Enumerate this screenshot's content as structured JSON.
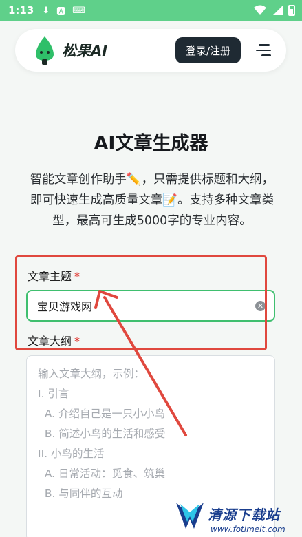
{
  "status_bar": {
    "time": "1:13",
    "icons": [
      "download-icon",
      "a-badge-icon",
      "keyboard-icon",
      "wifi-icon",
      "signal-icon",
      "battery-icon"
    ]
  },
  "header": {
    "brand": "松果AI",
    "login_label": "登录/注册",
    "brand_color": "#2fbf69"
  },
  "main": {
    "title": "AI文章生成器",
    "intro": "智能文章创作助手✏️，只需提供标题和大纲，即可快速生成高质量文章📝。支持多种文章类型，最高可生成5000字的专业内容。"
  },
  "form": {
    "topic_label": "文章主题",
    "topic_value": "宝贝游戏网",
    "outline_label": "文章大纲",
    "required_mark": "*",
    "outline_placeholder_lines": [
      "输入文章大纲，示例：",
      "I. 引言",
      "  A. 介绍自己是一只小小鸟",
      "  B. 简述小鸟的生活和感受",
      "",
      "II. 小鸟的生活",
      "  A. 日常活动：觅食、筑巢",
      "  B. 与同伴的互动"
    ]
  },
  "watermark": {
    "title": "清源下载站",
    "url": "www.fotimeit.com"
  },
  "colors": {
    "accent": "#3fbf6f",
    "annotation": "#e0483e",
    "status_bar": "#5fd08a",
    "button_dark": "#1f2a33"
  }
}
